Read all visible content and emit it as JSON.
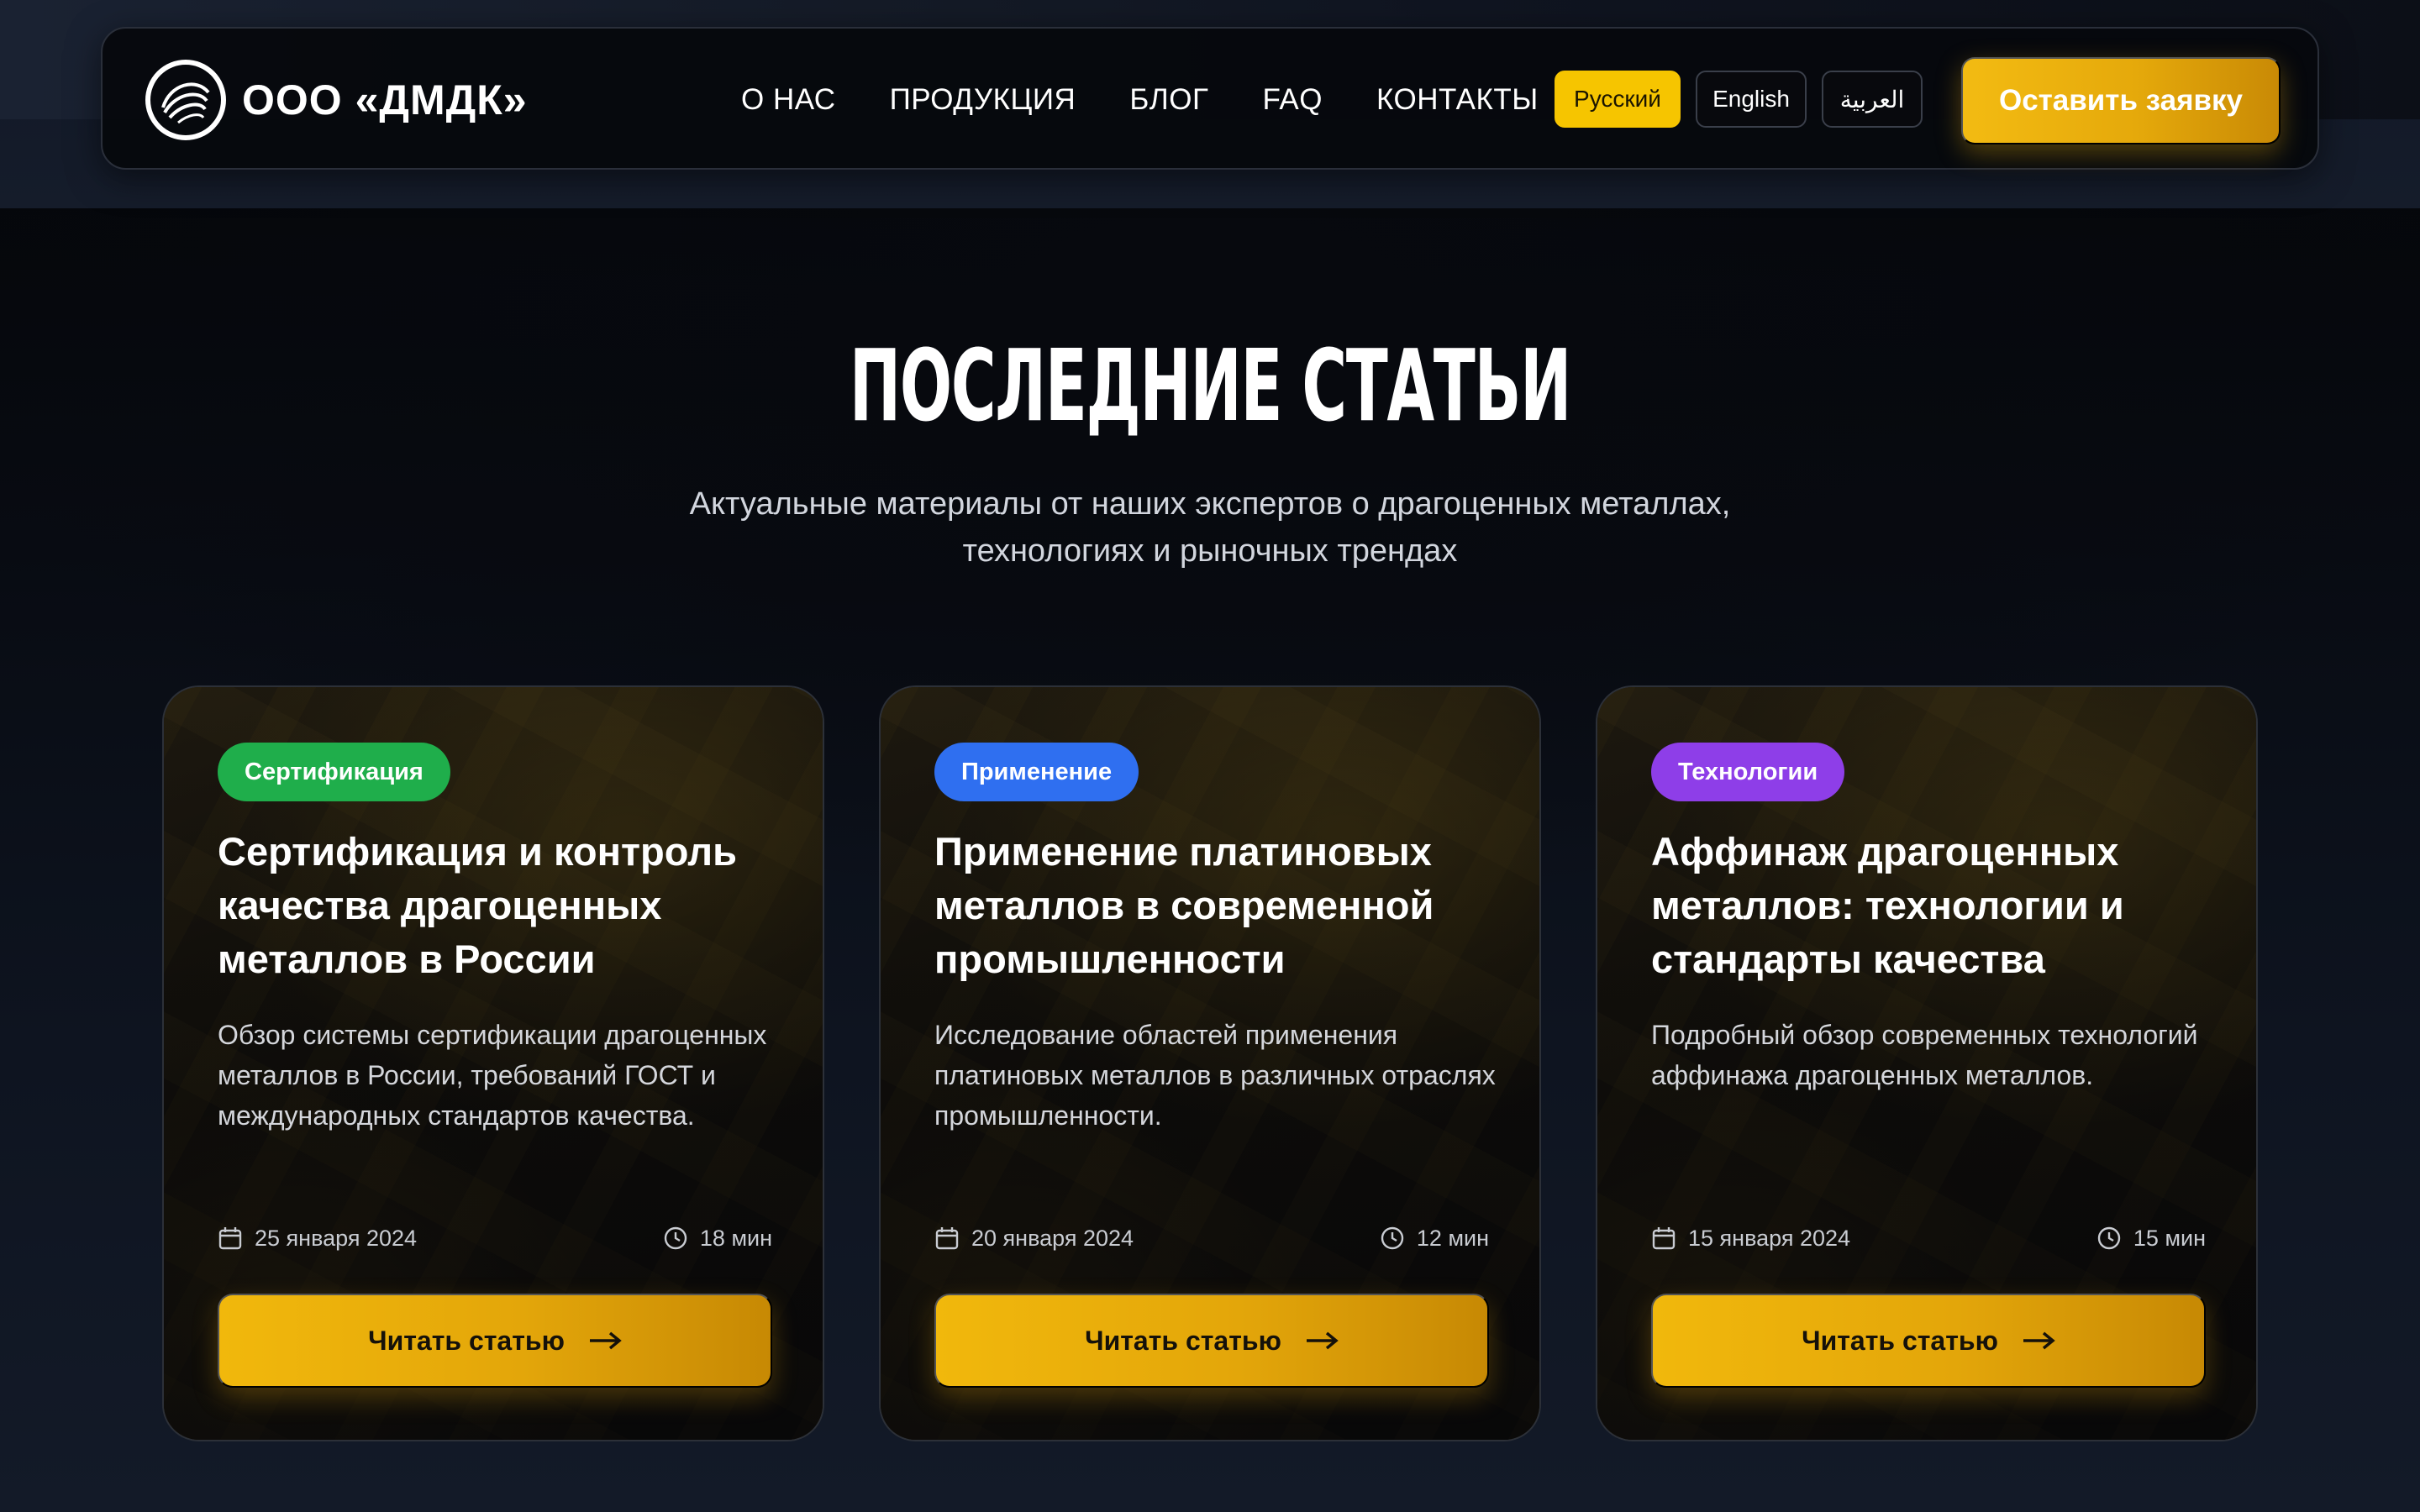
{
  "brand": {
    "name": "ООО «ДМДК»",
    "logo_icon": "circular-swirl-logo",
    "accent": "#f6c500"
  },
  "nav": {
    "links": [
      "О НАС",
      "ПРОДУКЦИЯ",
      "БЛОГ",
      "FAQ",
      "КОНТАКТЫ"
    ],
    "languages": [
      {
        "label": "Русский",
        "active": true
      },
      {
        "label": "English",
        "active": false
      },
      {
        "label": "العربية",
        "active": false
      }
    ],
    "cta_label": "Оставить заявку"
  },
  "section": {
    "title": "ПОСЛЕДНИЕ СТАТЬИ",
    "subtitle_line1": "Актуальные материалы от наших экспертов о драгоценных металлах,",
    "subtitle_line2": "технологиях и рыночных трендах"
  },
  "articles": [
    {
      "badge": "Сертификация",
      "badge_color": "#1fae4b",
      "title": "Сертификация и контроль качества драгоценных металлов в России",
      "description": "Обзор системы сертификации драгоценных металлов в России, требований ГОСТ и международных стандартов качества.",
      "date": "25 января 2024",
      "read_time": "18 мин",
      "button": "Читать статью"
    },
    {
      "badge": "Применение",
      "badge_color": "#2f6ff0",
      "title": "Применение платиновых металлов в современной промышленности",
      "description": "Исследование областей применения платиновых металлов в различных отраслях промышленности.",
      "date": "20 января 2024",
      "read_time": "12 мин",
      "button": "Читать статью"
    },
    {
      "badge": "Технологии",
      "badge_color": "#8e3ee8",
      "title": "Аффинаж драгоценных металлов: технологии и стандарты качества",
      "description": "Подробный обзор современных технологий аффинажа драгоценных металлов.",
      "date": "15 января 2024",
      "read_time": "15 мин",
      "button": "Читать статью"
    }
  ]
}
